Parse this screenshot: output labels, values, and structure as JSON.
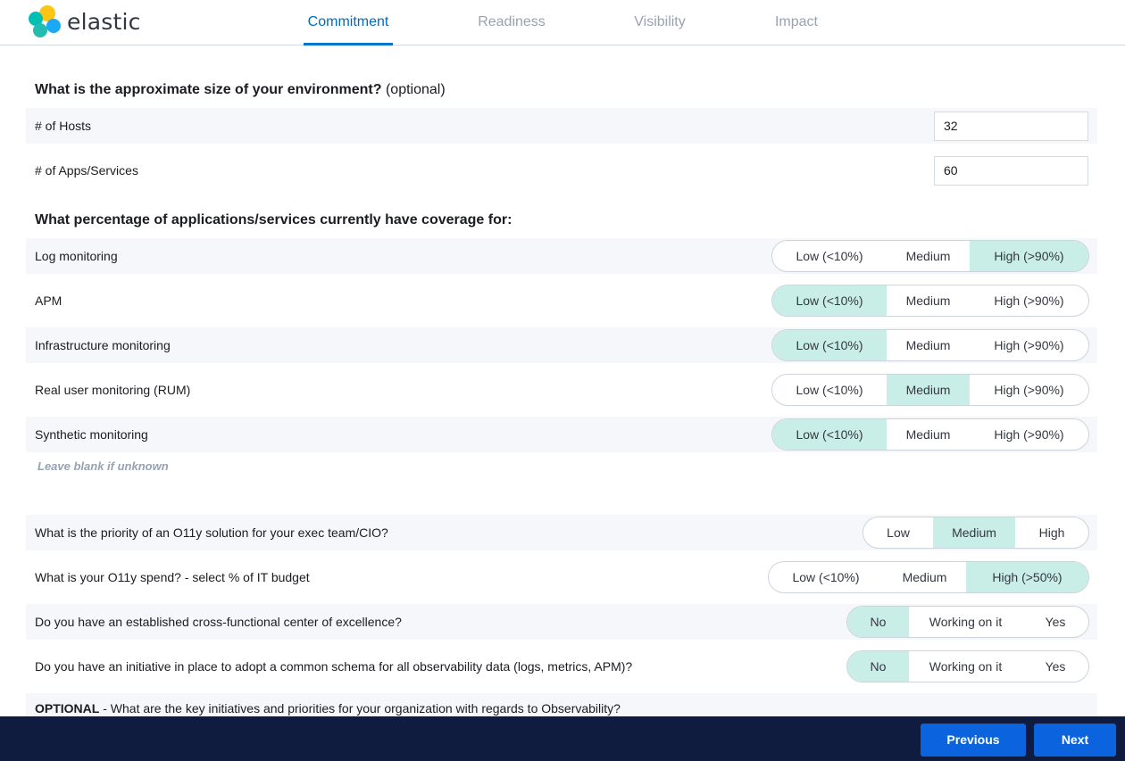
{
  "app": {
    "logo_text": "elastic"
  },
  "tabs": [
    {
      "label": "Commitment",
      "active": true
    },
    {
      "label": "Readiness",
      "active": false
    },
    {
      "label": "Visibility",
      "active": false
    },
    {
      "label": "Impact",
      "active": false
    }
  ],
  "environment": {
    "title": "What is the approximate size of your environment?",
    "title_suffix": "(optional)",
    "hosts_label": "# of Hosts",
    "hosts_value": "32",
    "apps_label": "# of Apps/Services",
    "apps_value": "60"
  },
  "coverage": {
    "title": "What percentage of applications/services currently have coverage for:",
    "options": [
      "Low (<10%)",
      "Medium",
      "High (>90%)"
    ],
    "rows": [
      {
        "label": "Log monitoring",
        "selected": "High (>90%)"
      },
      {
        "label": "APM",
        "selected": "Low (<10%)"
      },
      {
        "label": "Infrastructure monitoring",
        "selected": "Low (<10%)"
      },
      {
        "label": "Real user monitoring (RUM)",
        "selected": "Medium"
      },
      {
        "label": "Synthetic monitoring",
        "selected": "Low (<10%)"
      }
    ],
    "hint": "Leave blank if unknown"
  },
  "questions": [
    {
      "label": "What is the priority of an O11y solution for your exec team/CIO?",
      "options": [
        "Low",
        "Medium",
        "High"
      ],
      "selected": "Medium"
    },
    {
      "label": "What is your O11y spend? - select % of IT budget",
      "options": [
        "Low (<10%)",
        "Medium",
        "High  (>50%)"
      ],
      "selected": "High  (>50%)"
    },
    {
      "label": "Do you have an established cross-functional center of excellence?",
      "options": [
        "No",
        "Working on it",
        "Yes"
      ],
      "selected": "No"
    },
    {
      "label": "Do you have an initiative in place to adopt a common schema for all observability data (logs, metrics, APM)?",
      "options": [
        "No",
        "Working on it",
        "Yes"
      ],
      "selected": "No"
    }
  ],
  "optional_question": {
    "prefix": "OPTIONAL",
    "text": " - What are the key initiatives and priorities for your organization with regards to Observability?"
  },
  "footer": {
    "previous_label": "Previous",
    "next_label": "Next"
  },
  "colors": {
    "accent": "#0077cc",
    "selected_option": "#c9eee8",
    "footer_bg": "#101c3f",
    "button_bg": "#0b64dd"
  }
}
